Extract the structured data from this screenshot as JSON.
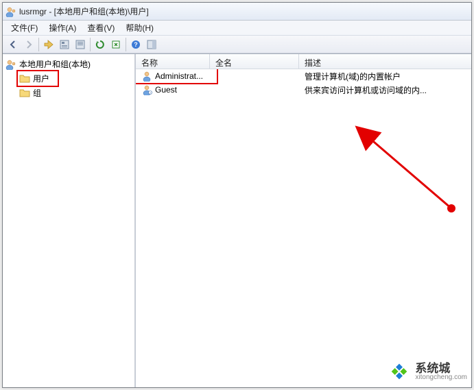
{
  "window": {
    "title": "lusrmgr - [本地用户和组(本地)\\用户]"
  },
  "menu": {
    "file": "文件(F)",
    "action": "操作(A)",
    "view": "查看(V)",
    "help": "帮助(H)"
  },
  "tree": {
    "root": "本地用户和组(本地)",
    "users": "用户",
    "groups": "组"
  },
  "columns": {
    "name": "名称",
    "fullname": "全名",
    "desc": "描述"
  },
  "rows": [
    {
      "name": "Administrat...",
      "fullname": "",
      "desc": "管理计算机(域)的内置帐户"
    },
    {
      "name": "Guest",
      "fullname": "",
      "desc": "供来宾访问计算机或访问域的内..."
    }
  ],
  "watermark": {
    "zh": "系统城",
    "en": "xitongcheng.com"
  }
}
